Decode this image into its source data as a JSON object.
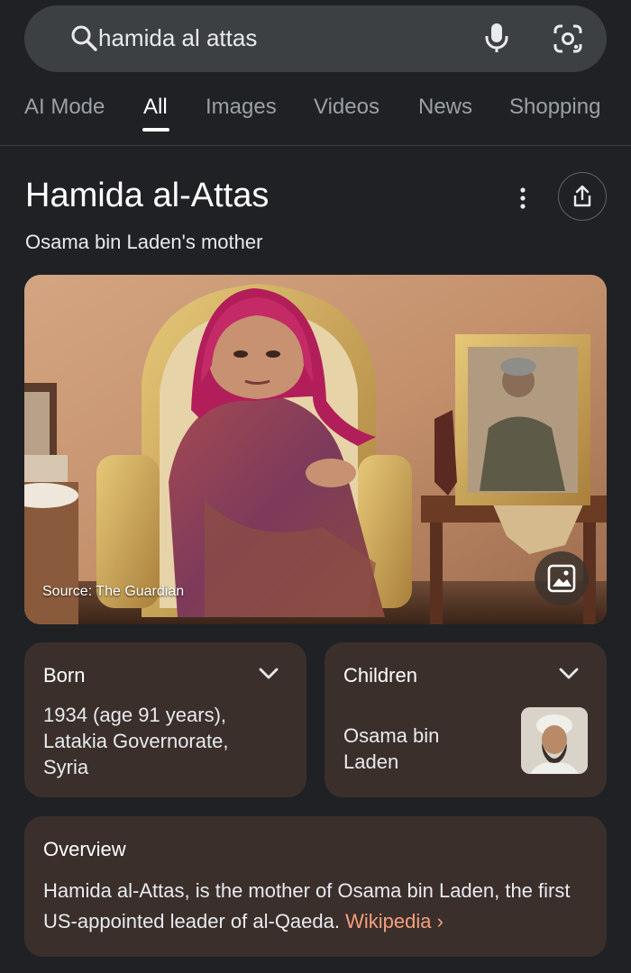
{
  "search": {
    "query": "hamida al attas"
  },
  "tabs": [
    "AI Mode",
    "All",
    "Images",
    "Videos",
    "News",
    "Shopping"
  ],
  "entity": {
    "title": "Hamida al-Attas",
    "subtitle": "Osama bin Laden's mother"
  },
  "photo": {
    "source": "Source: The Guardian"
  },
  "born": {
    "heading": "Born",
    "value": "1934 (age 91 years), Latakia Governorate, Syria"
  },
  "children": {
    "heading": "Children",
    "name": "Osama bin Laden"
  },
  "overview": {
    "heading": "Overview",
    "text": "Hamida al-Attas, is the mother of Osama bin Laden, the first US-appointed leader of al-Qaeda. ",
    "link": "Wikipedia ›"
  },
  "icons": {
    "search": "search-icon",
    "mic": "microphone-icon",
    "lens": "lens-icon",
    "more": "more-vert-icon",
    "share": "share-icon",
    "image": "image-icon",
    "chevron": "chevron-down-icon"
  },
  "colors": {
    "background": "#1f2125",
    "search_bar": "#3c4043",
    "card": "#3a2f2b",
    "link": "#f7a07f"
  }
}
